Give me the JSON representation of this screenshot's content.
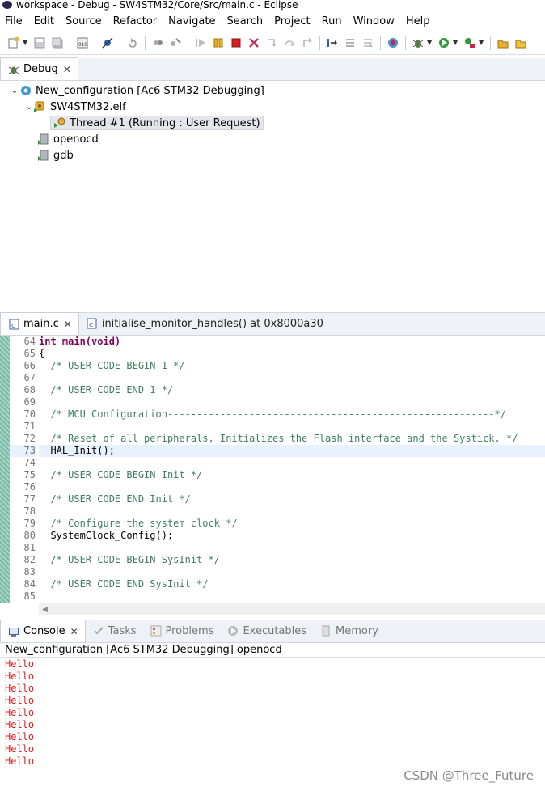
{
  "window": {
    "title": "workspace - Debug - SW4STM32/Core/Src/main.c - Eclipse"
  },
  "menu": [
    "File",
    "Edit",
    "Source",
    "Refactor",
    "Navigate",
    "Search",
    "Project",
    "Run",
    "Window",
    "Help"
  ],
  "debug_view": {
    "tab_label": "Debug",
    "tree": [
      {
        "label": "New_configuration [Ac6 STM32 Debugging]",
        "level": 0,
        "icon": "debug-launch-icon"
      },
      {
        "label": "SW4STM32.elf",
        "level": 1,
        "icon": "process-icon"
      },
      {
        "label": "Thread #1 (Running : User Request)",
        "level": 2,
        "icon": "thread-icon"
      },
      {
        "label": "openocd",
        "level": 1,
        "icon": "process-icon"
      },
      {
        "label": "gdb",
        "level": 1,
        "icon": "process-icon"
      }
    ]
  },
  "editor": {
    "tabs": [
      {
        "label": "main.c",
        "active": true
      },
      {
        "label": "initialise_monitor_handles() at 0x8000a30",
        "active": false
      }
    ],
    "lines": [
      {
        "n": "64",
        "text": "int main(void)",
        "kind": "kw"
      },
      {
        "n": "65",
        "text": "{",
        "kind": "code"
      },
      {
        "n": "66",
        "text": "  /* USER CODE BEGIN 1 */",
        "kind": "cm"
      },
      {
        "n": "67",
        "text": "",
        "kind": "code"
      },
      {
        "n": "68",
        "text": "  /* USER CODE END 1 */",
        "kind": "cm"
      },
      {
        "n": "69",
        "text": "",
        "kind": "code"
      },
      {
        "n": "70",
        "text": "  /* MCU Configuration--------------------------------------------------------*/",
        "kind": "cm"
      },
      {
        "n": "71",
        "text": "",
        "kind": "code"
      },
      {
        "n": "72",
        "text": "  /* Reset of all peripherals, Initializes the Flash interface and the Systick. */",
        "kind": "cm"
      },
      {
        "n": "73",
        "text": "  HAL_Init();",
        "kind": "cur"
      },
      {
        "n": "74",
        "text": "",
        "kind": "code"
      },
      {
        "n": "75",
        "text": "  /* USER CODE BEGIN Init */",
        "kind": "cm"
      },
      {
        "n": "76",
        "text": "",
        "kind": "code"
      },
      {
        "n": "77",
        "text": "  /* USER CODE END Init */",
        "kind": "cm"
      },
      {
        "n": "78",
        "text": "",
        "kind": "code"
      },
      {
        "n": "79",
        "text": "  /* Configure the system clock */",
        "kind": "cm"
      },
      {
        "n": "80",
        "text": "  SystemClock_Config();",
        "kind": "code"
      },
      {
        "n": "81",
        "text": "",
        "kind": "code"
      },
      {
        "n": "82",
        "text": "  /* USER CODE BEGIN SysInit */",
        "kind": "cm"
      },
      {
        "n": "83",
        "text": "",
        "kind": "code"
      },
      {
        "n": "84",
        "text": "  /* USER CODE END SysInit */",
        "kind": "cm"
      },
      {
        "n": "85",
        "text": "",
        "kind": "code"
      }
    ]
  },
  "console": {
    "tabs": [
      "Console",
      "Tasks",
      "Problems",
      "Executables",
      "Memory"
    ],
    "process": "New_configuration [Ac6 STM32 Debugging] openocd",
    "output": [
      "Hello",
      "Hello",
      "Hello",
      "Hello",
      "Hello",
      "Hello",
      "Hello",
      "Hello",
      "Hello"
    ]
  },
  "watermark": "CSDN @Three_Future"
}
